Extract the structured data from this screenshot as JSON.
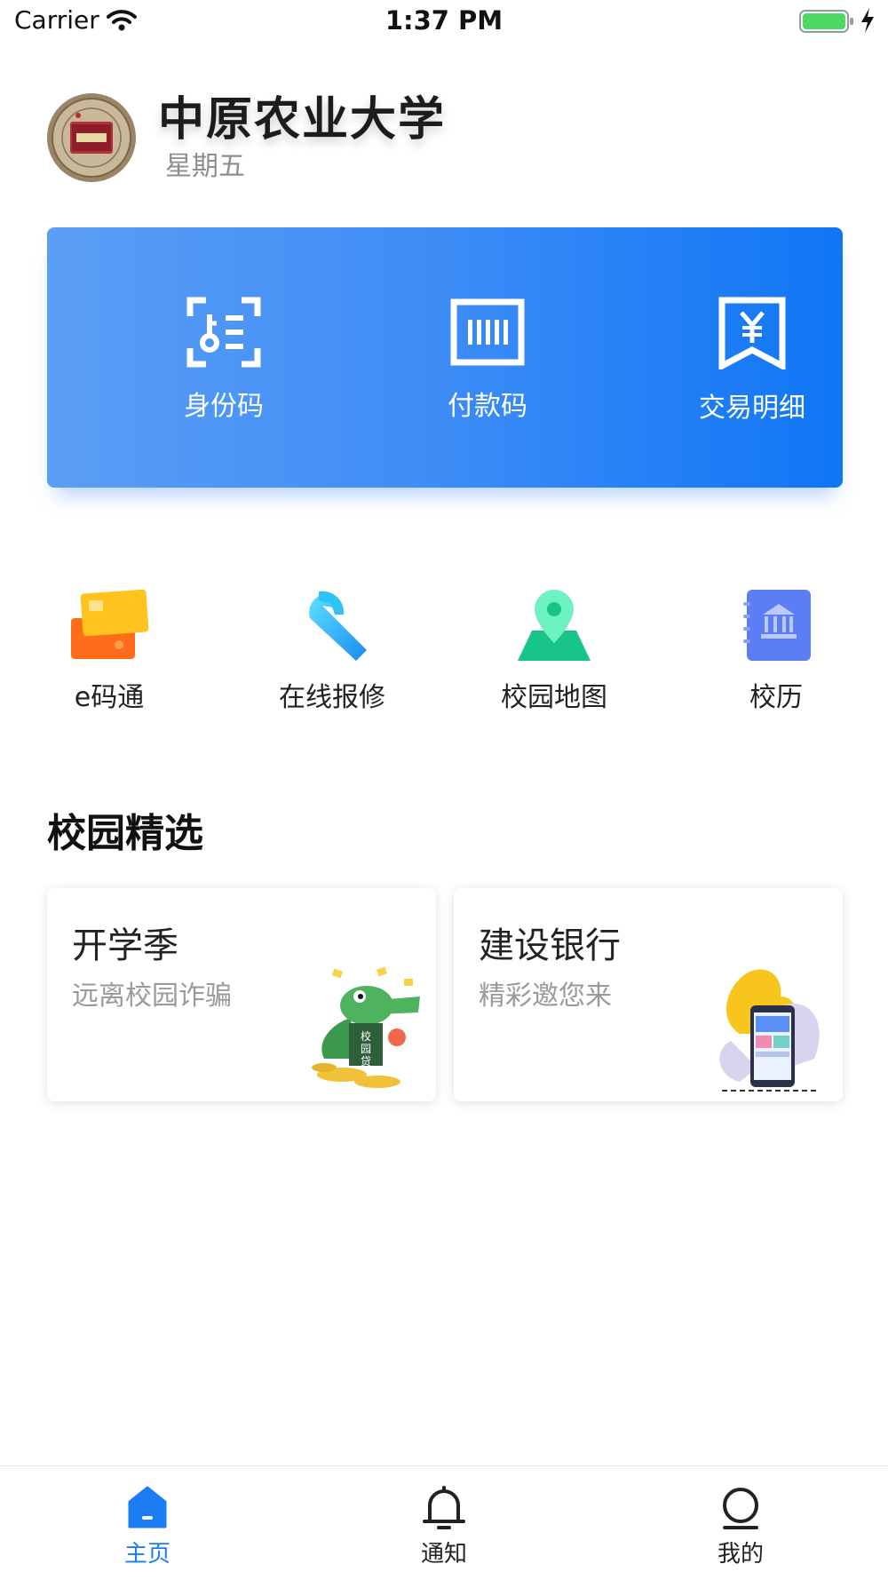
{
  "status_bar": {
    "carrier": "Carrier",
    "time": "1:37 PM"
  },
  "header": {
    "university_name": "中原农业大学",
    "weekday": "星期五"
  },
  "top_card": {
    "items": [
      {
        "label": "身份码",
        "icon": "id-code-icon"
      },
      {
        "label": "付款码",
        "icon": "barcode-icon"
      },
      {
        "label": "交易明细",
        "icon": "yuan-receipt-icon"
      }
    ]
  },
  "apps": [
    {
      "label": "e码通",
      "icon": "cards-icon"
    },
    {
      "label": "在线报修",
      "icon": "wrench-icon"
    },
    {
      "label": "校园地图",
      "icon": "map-pin-icon"
    },
    {
      "label": "校历",
      "icon": "calendar-book-icon"
    }
  ],
  "section": {
    "title": "校园精选"
  },
  "promos": [
    {
      "title": "开学季",
      "subtitle": "远离校园诈骗",
      "sign_text": "校园贷"
    },
    {
      "title": "建设银行",
      "subtitle": "精彩邀您来"
    }
  ],
  "tabs": [
    {
      "label": "主页",
      "icon": "home-icon",
      "active": true
    },
    {
      "label": "通知",
      "icon": "bell-icon",
      "active": false
    },
    {
      "label": "我的",
      "icon": "profile-icon",
      "active": false
    }
  ],
  "colors": {
    "accent": "#1c7cf4",
    "card_gradient_start": "#5b9ef5",
    "card_gradient_end": "#0f76f5"
  }
}
